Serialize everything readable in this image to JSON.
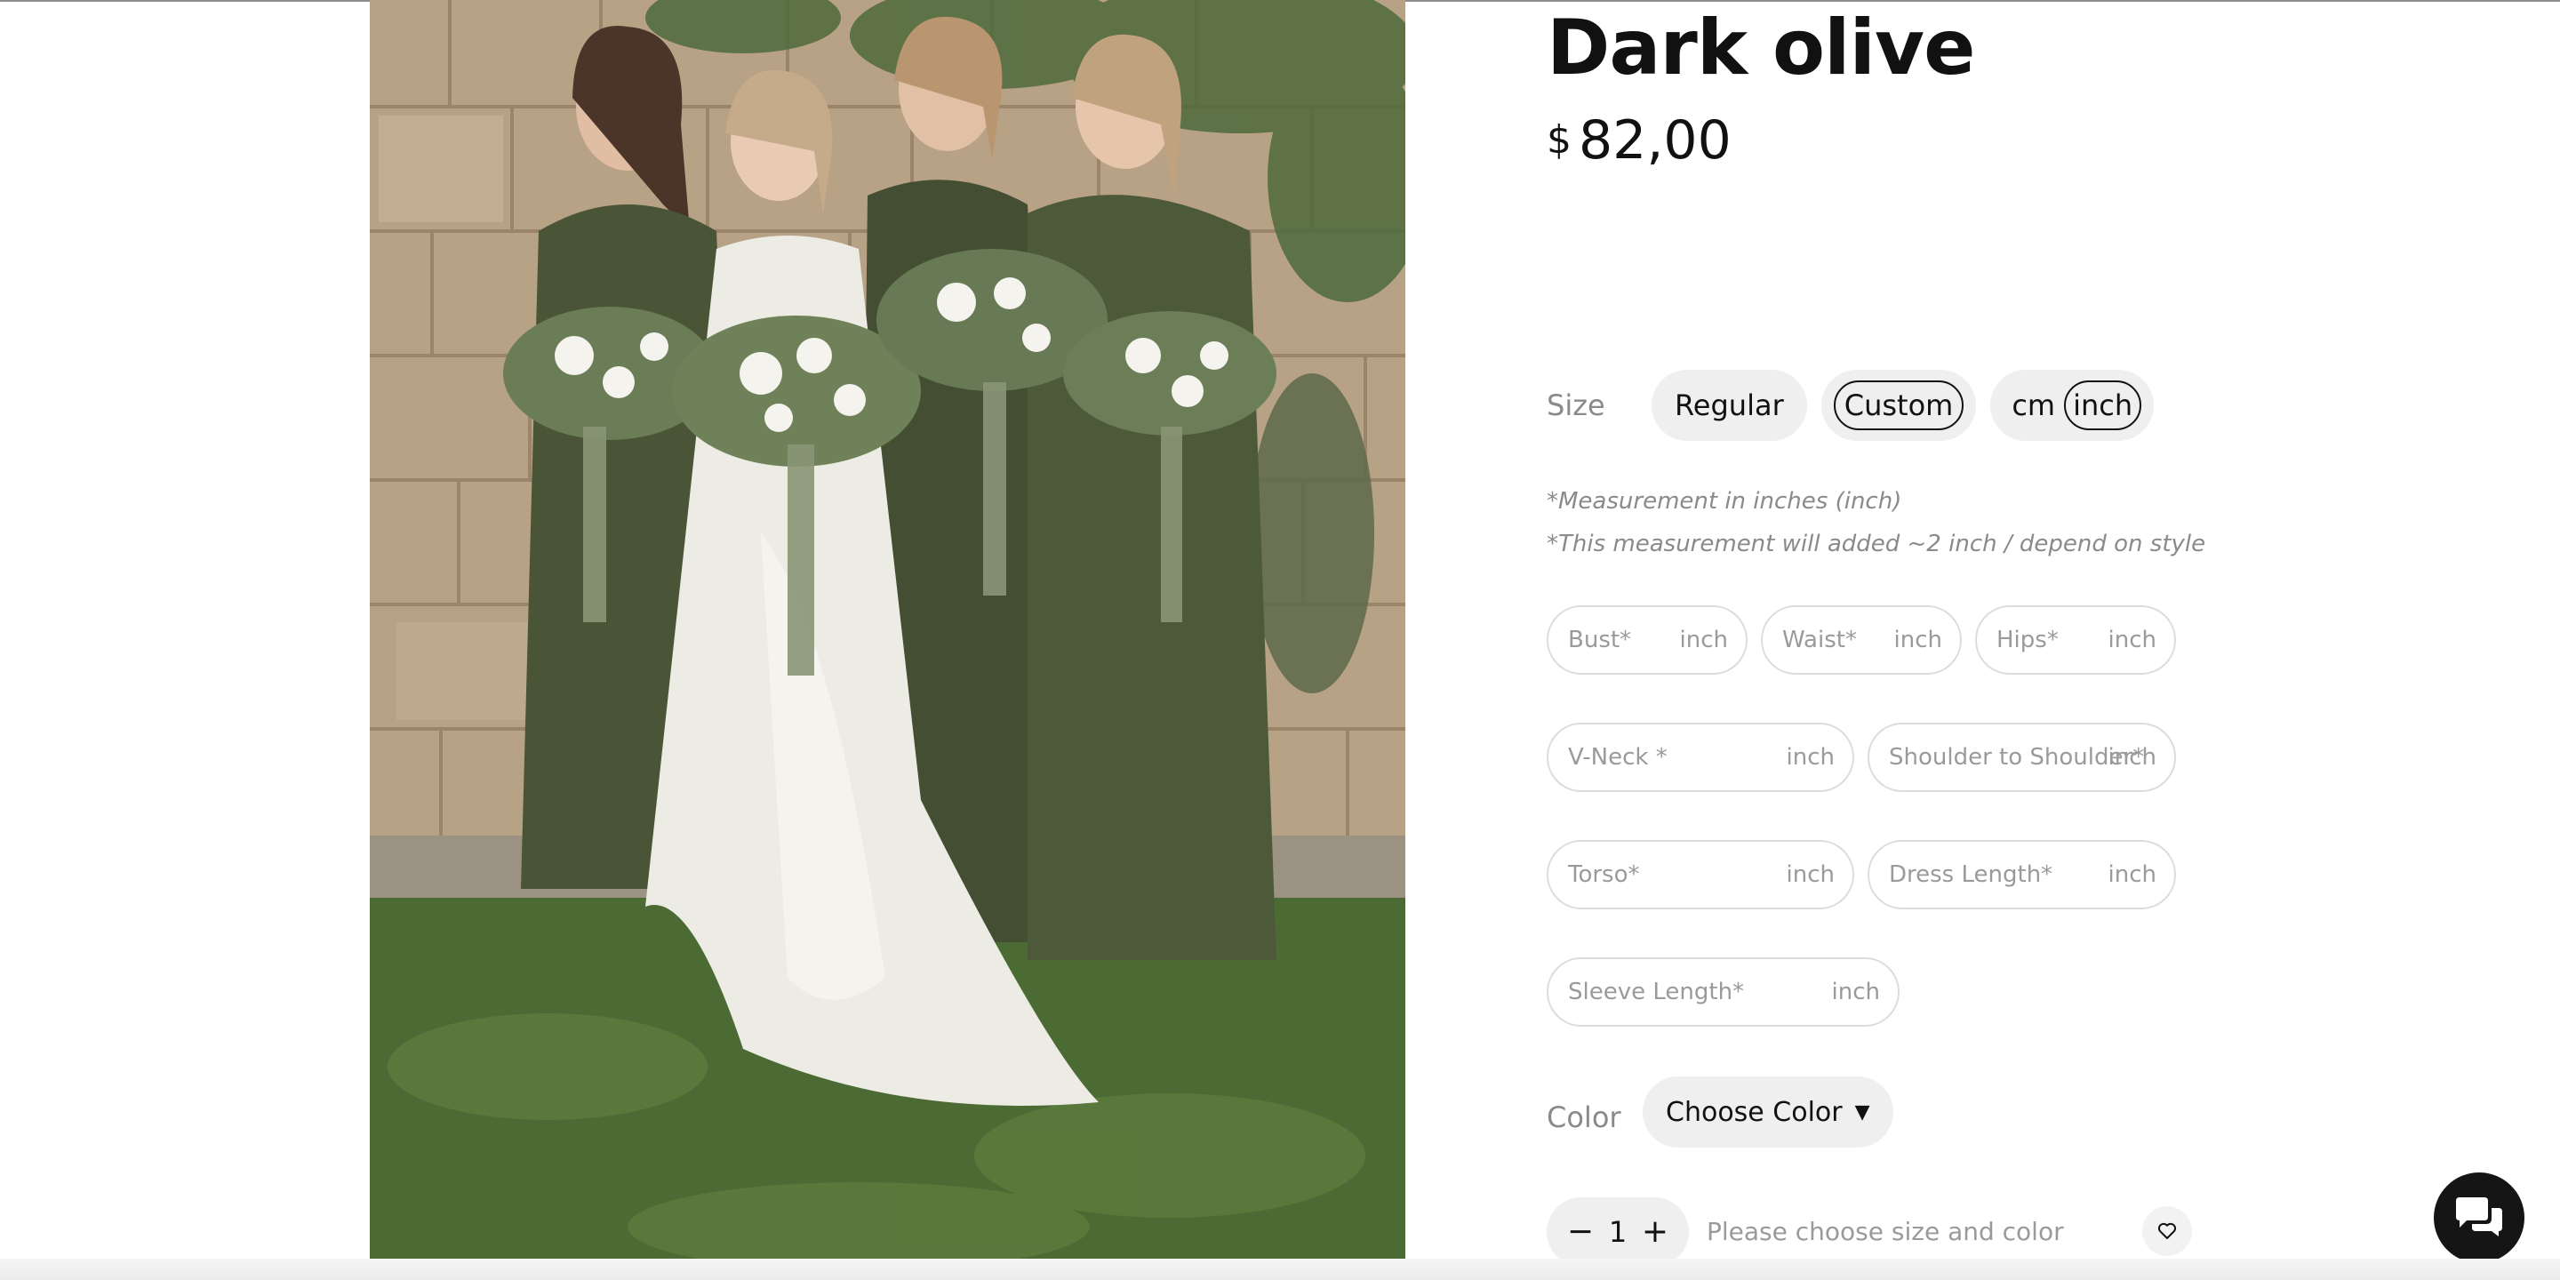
{
  "product": {
    "title": "Dark olive",
    "currency": "$",
    "price": "82,00",
    "image_alt": "bridesmaids in dark olive dresses with bride"
  },
  "size": {
    "label": "Size",
    "options": [
      "Regular",
      "Custom"
    ],
    "selected": "Custom",
    "units": [
      "cm",
      "inch"
    ],
    "selected_unit": "inch"
  },
  "notes": [
    "*Measurement in inches (inch)",
    "*This measurement will added ~2 inch / depend on style"
  ],
  "measurements": [
    {
      "placeholder": "Bust*",
      "unit": "inch"
    },
    {
      "placeholder": "Waist*",
      "unit": "inch"
    },
    {
      "placeholder": "Hips*",
      "unit": "inch"
    },
    {
      "placeholder": "V-Neck *",
      "unit": "inch"
    },
    {
      "placeholder": "Shoulder to Shoulder*",
      "unit": "inch"
    },
    {
      "placeholder": "Torso*",
      "unit": "inch"
    },
    {
      "placeholder": "Dress Length*",
      "unit": "inch"
    },
    {
      "placeholder": "Sleeve Length*",
      "unit": "inch"
    }
  ],
  "color": {
    "label": "Color",
    "placeholder": "Choose Color",
    "caret": "▼"
  },
  "cart": {
    "minus": "−",
    "quantity": "1",
    "plus": "+",
    "hint": "Please choose size and color"
  },
  "icons": {
    "wishlist": "heart-icon",
    "chat": "chat-icon"
  },
  "colors": {
    "pill_bg": "#efefef",
    "field_border": "#dcdcdc",
    "muted_text": "#8a8a8a",
    "chat_bg": "#151515",
    "dress_olive": "#4a5538"
  }
}
